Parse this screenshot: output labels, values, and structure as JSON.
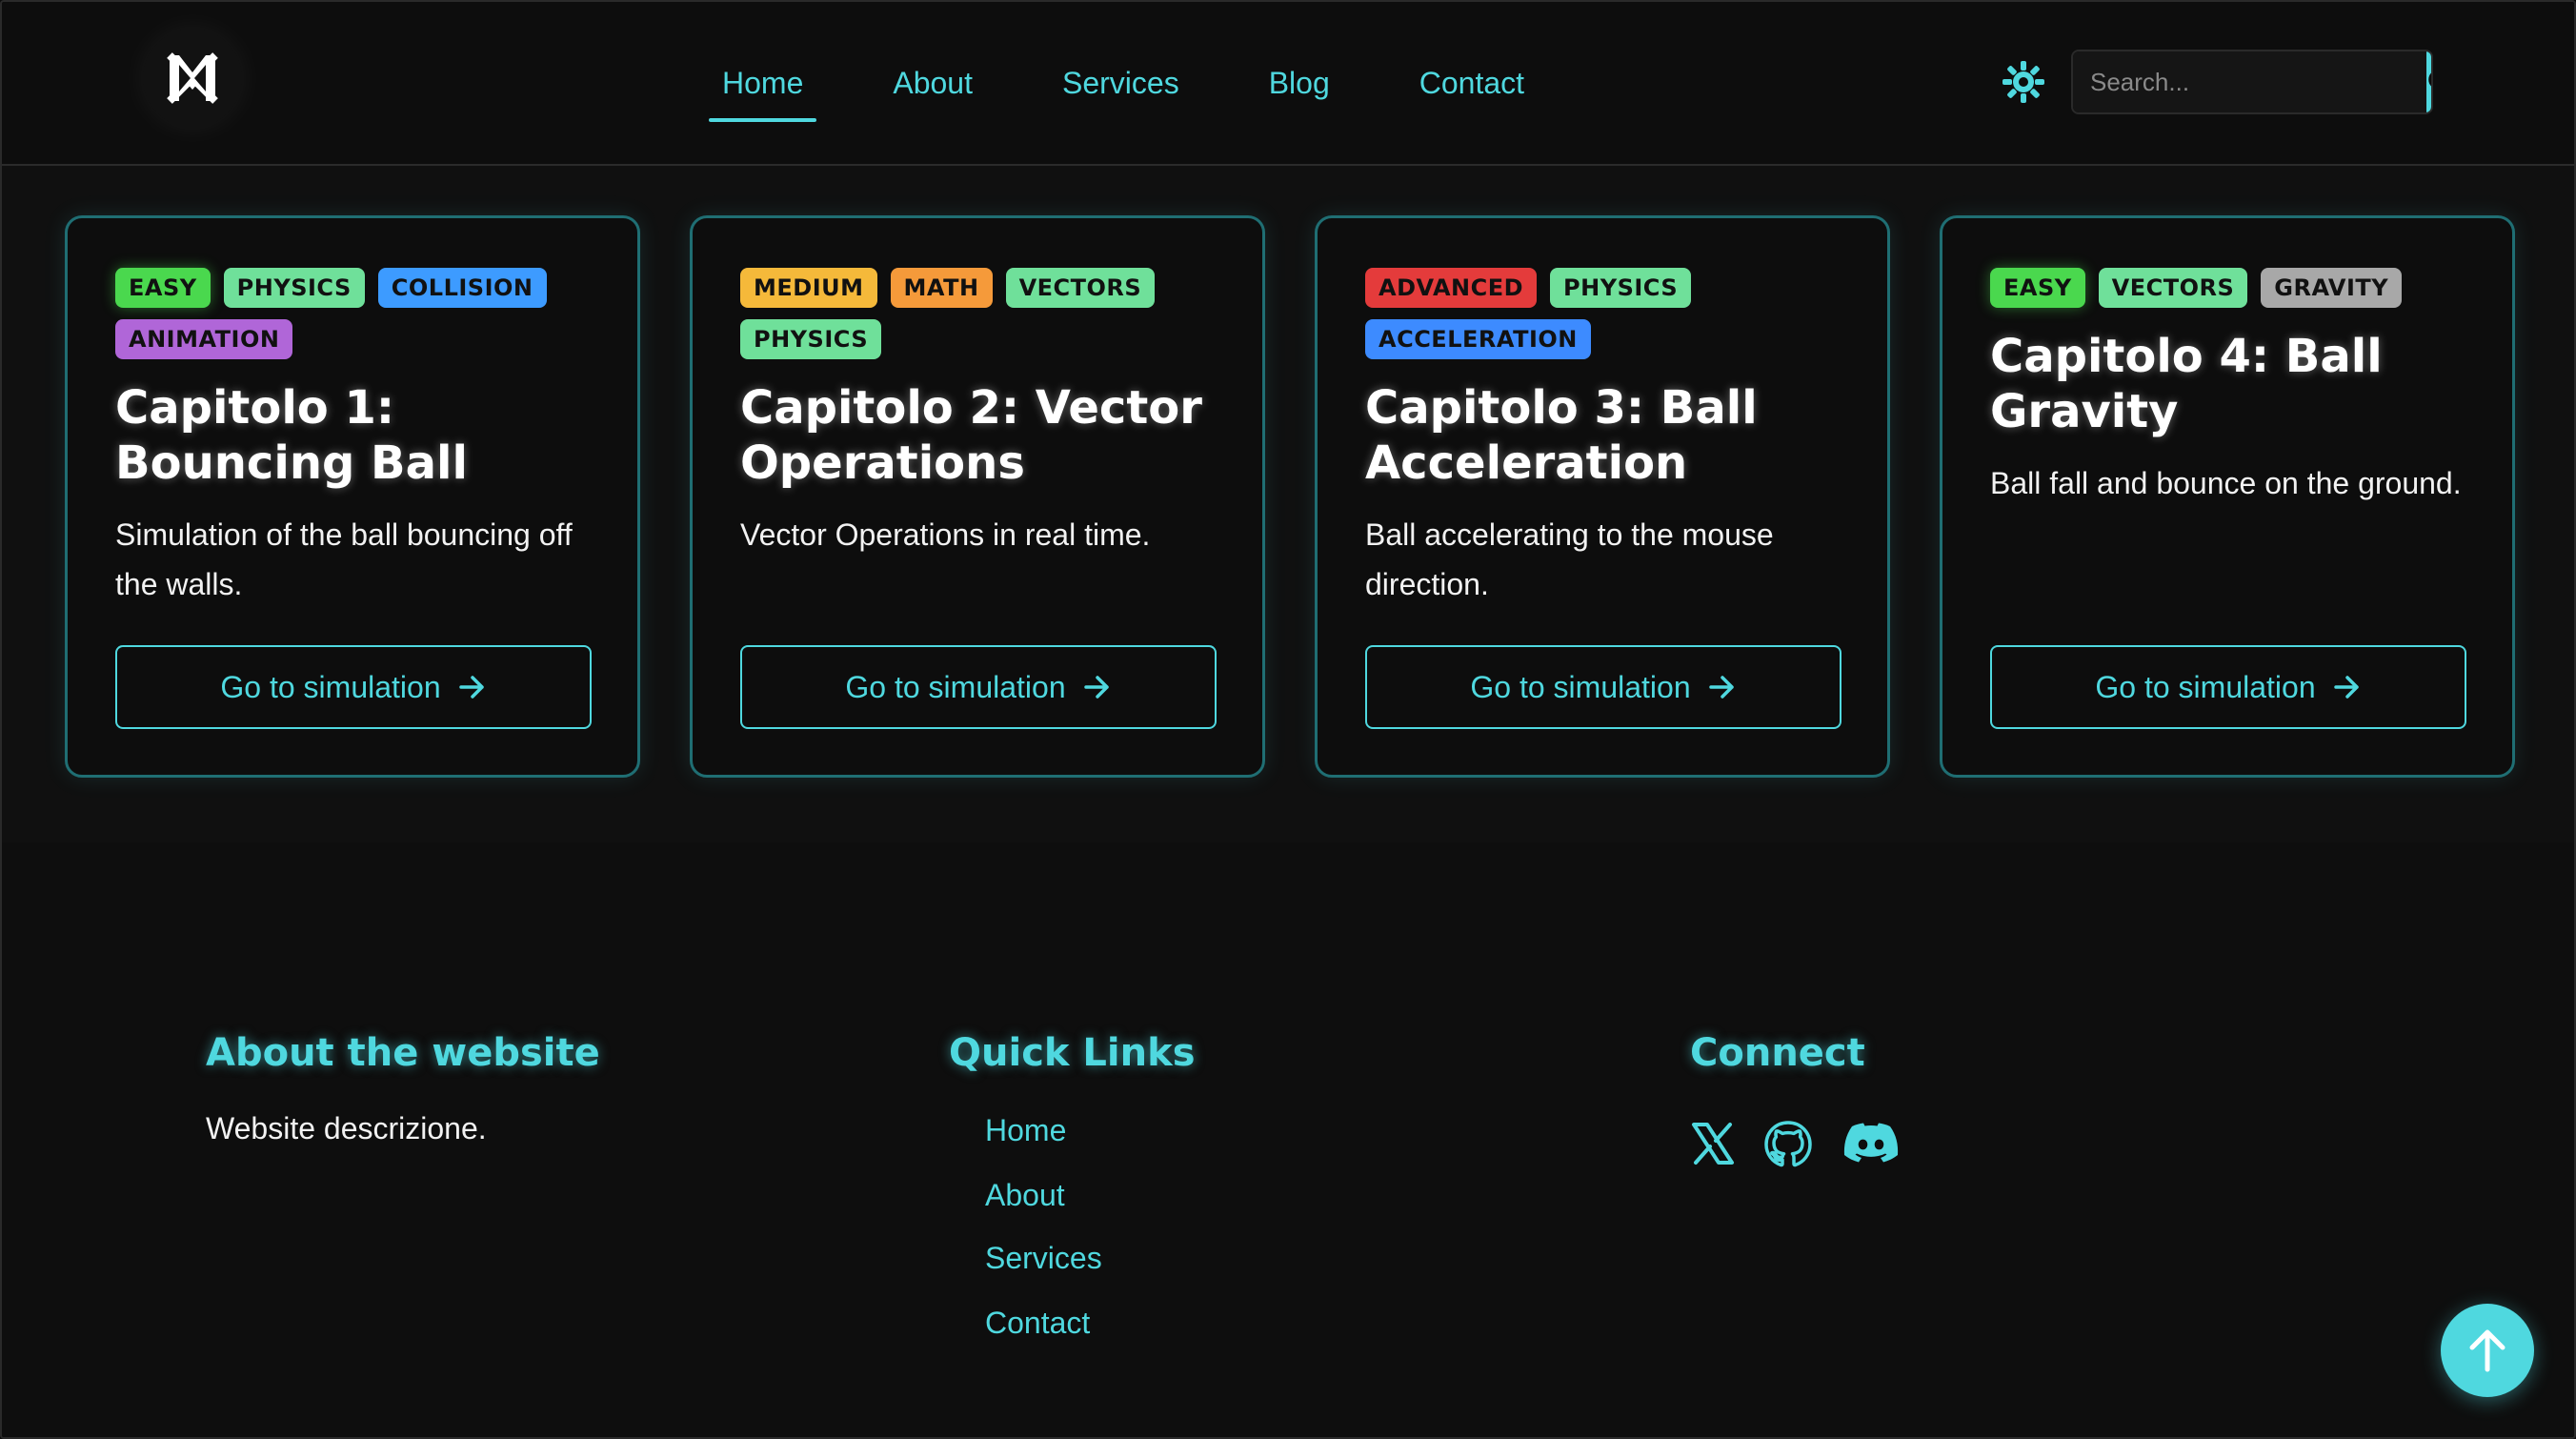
{
  "nav": {
    "logo": "logo-m-icon",
    "links": [
      "Home",
      "About",
      "Services",
      "Blog",
      "Contact"
    ],
    "active": "Home",
    "theme_toggle_icon": "sun-gear-icon",
    "search": {
      "placeholder": "Search...",
      "value": ""
    },
    "search_button_icon": "search-icon"
  },
  "cards": [
    {
      "tags": [
        "EASY",
        "PHYSICS",
        "COLLISION",
        "ANIMATION"
      ],
      "title": "Capitolo 1: Bouncing Ball",
      "description": "Simulation of the ball bouncing off the walls.",
      "button_label": "Go to simulation"
    },
    {
      "tags": [
        "MEDIUM",
        "MATH",
        "VECTORS",
        "PHYSICS"
      ],
      "title": "Capitolo 2: Vector Operations",
      "description": "Vector Operations in real time.",
      "button_label": "Go to simulation"
    },
    {
      "tags": [
        "ADVANCED",
        "PHYSICS",
        "ACCELERATION"
      ],
      "title": "Capitolo 3: Ball Acceleration",
      "description": "Ball accelerating to the mouse direction.",
      "button_label": "Go to simulation"
    },
    {
      "tags": [
        "EASY",
        "VECTORS",
        "GRAVITY"
      ],
      "title": "Capitolo 4: Ball Gravity",
      "description": "Ball fall and bounce on the ground.",
      "button_label": "Go to simulation"
    }
  ],
  "footer": {
    "about": {
      "heading": "About the website",
      "text": "Website descrizione."
    },
    "quick_links": {
      "heading": "Quick Links",
      "links": [
        "Home",
        "About",
        "Services",
        "Contact"
      ]
    },
    "connect": {
      "heading": "Connect",
      "icons": [
        "x-twitter-icon",
        "github-icon",
        "discord-icon"
      ]
    }
  },
  "scroll_top_icon": "arrow-up-icon",
  "colors": {
    "accent": "#4fd8df",
    "background": "#101010",
    "card_border": "#1f6e73"
  }
}
